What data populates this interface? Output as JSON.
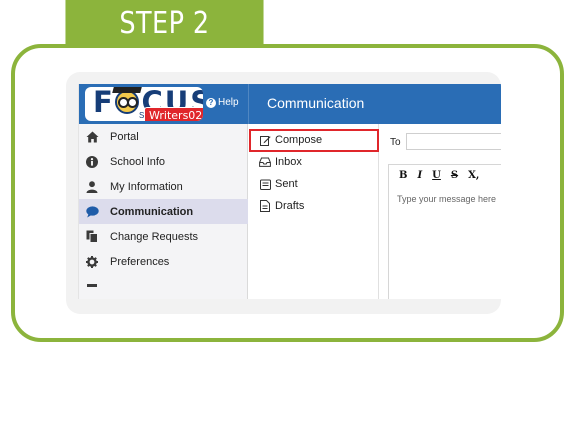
{
  "step_label": "STEP 2",
  "header": {
    "logo_text": "FOCUS",
    "logo_small": "S",
    "user_badge": "Writers02",
    "help_label": "Help",
    "page_title": "Communication"
  },
  "sidebar": {
    "items": [
      {
        "label": "Portal",
        "icon": "home-icon"
      },
      {
        "label": "School Info",
        "icon": "info-icon"
      },
      {
        "label": "My Information",
        "icon": "user-icon"
      },
      {
        "label": "Communication",
        "icon": "chat-bubble-icon",
        "active": true
      },
      {
        "label": "Change Requests",
        "icon": "documents-icon"
      },
      {
        "label": "Preferences",
        "icon": "gear-icon"
      }
    ]
  },
  "submenu": {
    "items": [
      {
        "label": "Compose",
        "icon": "edit-icon",
        "highlighted": true
      },
      {
        "label": "Inbox",
        "icon": "inbox-icon"
      },
      {
        "label": "Sent",
        "icon": "sent-tray-icon"
      },
      {
        "label": "Drafts",
        "icon": "draft-document-icon"
      }
    ]
  },
  "compose": {
    "to_label": "To",
    "to_value": "",
    "toolbar": [
      "B",
      "I",
      "U",
      "S",
      "X,"
    ],
    "placeholder": "Type your message here"
  },
  "colors": {
    "step_green": "#8cb43c",
    "header_blue": "#2a6db5",
    "highlight_red": "#e0262b",
    "active_nav": "#dcdcec"
  }
}
